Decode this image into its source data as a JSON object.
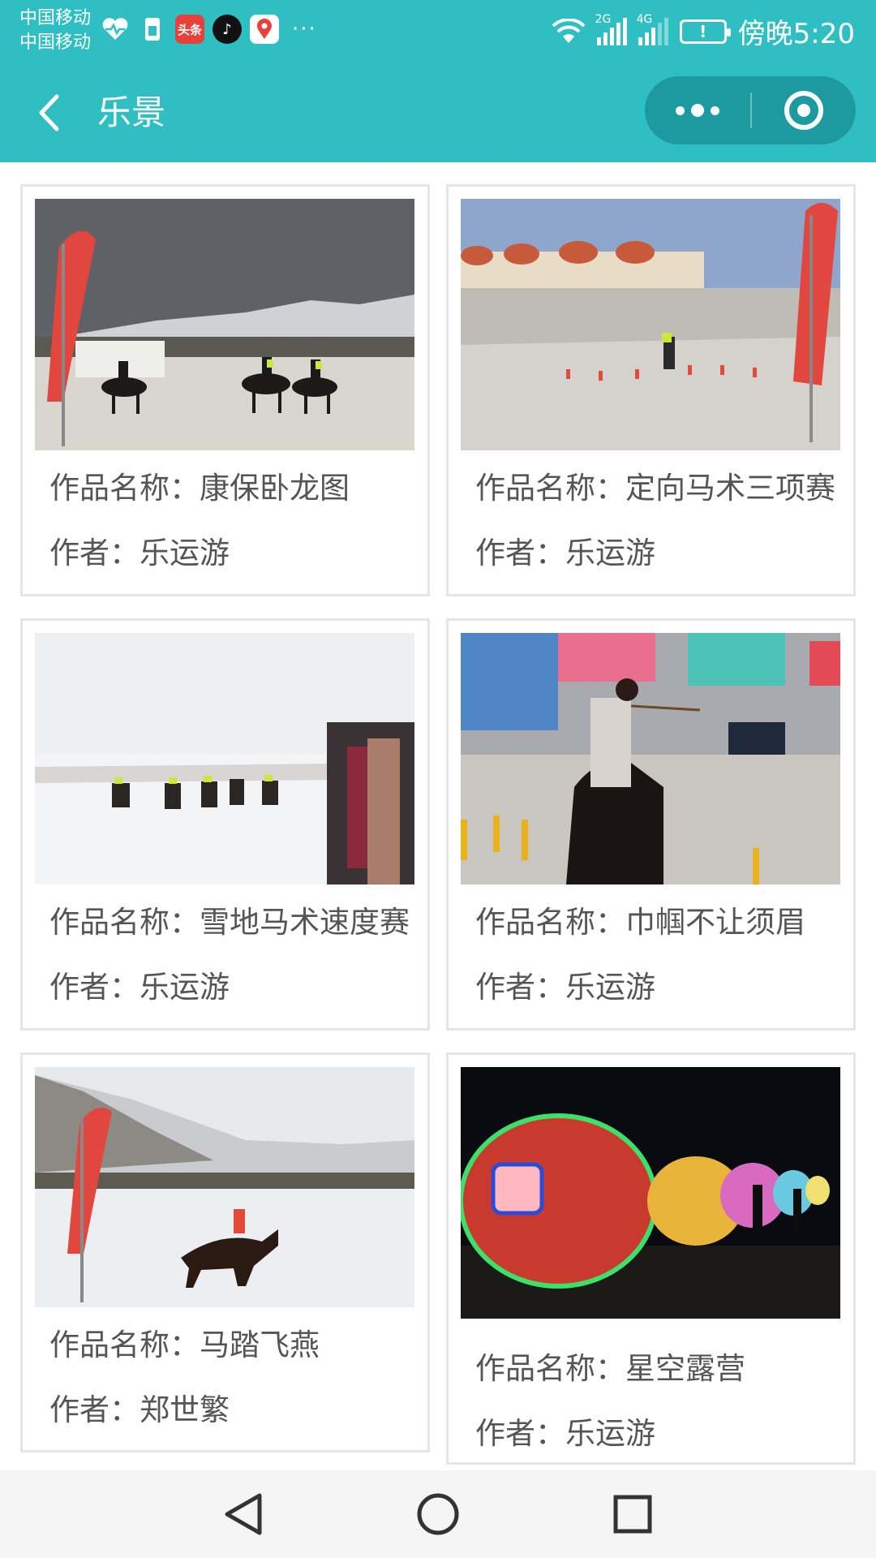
{
  "status": {
    "carrier1": "中国移动",
    "carrier2": "中国移动",
    "net1": "2G",
    "net2": "4G",
    "battery": "!",
    "time": "傍晚5:20",
    "more": "···",
    "apps": [
      {
        "icon": "heart-rate-icon",
        "label": ""
      },
      {
        "icon": "sim-card-icon",
        "label": ""
      },
      {
        "icon": "toutiao-icon",
        "label": "头条"
      },
      {
        "icon": "tiktok-icon",
        "label": "♪"
      },
      {
        "icon": "map-pin-icon",
        "label": ""
      }
    ]
  },
  "nav": {
    "title": "乐景"
  },
  "cards": [
    {
      "name": "作品名称：康保卧龙图",
      "author": "作者：乐运游",
      "photo": "horse-racing-snow"
    },
    {
      "name": "作品名称：定向马术三项赛",
      "author": "作者：乐运游",
      "photo": "yurt-horse-course"
    },
    {
      "name": "作品名称：雪地马术速度赛",
      "author": "作者：乐运游",
      "photo": "snow-race-crowd"
    },
    {
      "name": "作品名称：巾帼不让须眉",
      "author": "作者：乐运游",
      "photo": "mounted-archer"
    },
    {
      "name": "作品名称：马踏飞燕",
      "author": "作者：郑世繁",
      "photo": "gallop-hillside"
    },
    {
      "name": "作品名称：星空露营",
      "author": "作者：乐运游",
      "photo": "glowing-bubble-tents"
    }
  ],
  "colors": {
    "brand": "#2fbfc3",
    "capsule": "#1d9aa0",
    "card_border": "#e6e6e6",
    "text": "#555555"
  }
}
